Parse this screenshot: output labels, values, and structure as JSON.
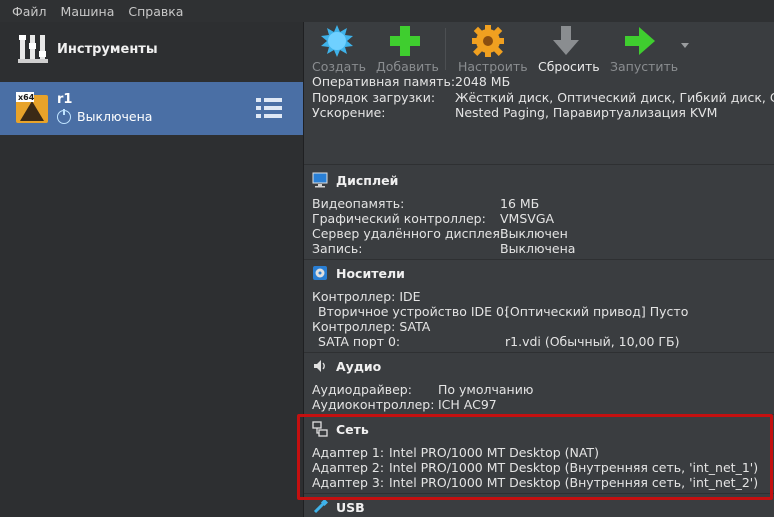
{
  "menu": [
    {
      "label": "Файл"
    },
    {
      "label": "Машина"
    },
    {
      "label": "Справка"
    }
  ],
  "sidebar": {
    "tools_title": "Инструменты",
    "vm": {
      "name": "r1",
      "state": "Выключена",
      "os_badge": "x64"
    }
  },
  "toolbar": {
    "create": "Создать",
    "add": "Добавить",
    "settings": "Настроить",
    "discard": "Сбросить",
    "start": "Запустить"
  },
  "system": {
    "rows": [
      {
        "label": "Оперативная память:",
        "value": "2048 МБ"
      },
      {
        "label": "Порядок загрузки:",
        "value": "Жёсткий диск, Оптический диск, Гибкий диск, Сеть"
      },
      {
        "label": "Ускорение:",
        "value": "Nested Paging, Паравиртуализация KVM"
      }
    ]
  },
  "display": {
    "title": "Дисплей",
    "rows": [
      {
        "label": "Видеопамять:",
        "value": "16 МБ"
      },
      {
        "label": "Графический контроллер:",
        "value": "VMSVGA"
      },
      {
        "label": "Сервер удалённого дисплея:",
        "value": "Выключен"
      },
      {
        "label": "Запись:",
        "value": "Выключена"
      }
    ]
  },
  "storage": {
    "title": "Носители",
    "rows": [
      {
        "label": "Контроллер: IDE",
        "value": ""
      },
      {
        "label": "Вторичное устройство IDE 0:",
        "value": "[Оптический привод] Пусто"
      },
      {
        "label": "Контроллер: SATA",
        "value": ""
      },
      {
        "label": "SATA порт 0:",
        "value": "r1.vdi (Обычный, 10,00 ГБ)"
      }
    ]
  },
  "audio": {
    "title": "Аудио",
    "rows": [
      {
        "label": "Аудиодрайвер:",
        "value": "По умолчанию"
      },
      {
        "label": "Аудиоконтроллер:",
        "value": "ICH AC97"
      }
    ]
  },
  "network": {
    "title": "Сеть",
    "rows": [
      {
        "label": "Адаптер 1:",
        "value": "Intel PRO/1000 MT Desktop (NAT)"
      },
      {
        "label": "Адаптер 2:",
        "value": "Intel PRO/1000 MT Desktop (Внутренняя сеть, 'int_net_1')"
      },
      {
        "label": "Адаптер 3:",
        "value": "Intel PRO/1000 MT Desktop (Внутренняя сеть, 'int_net_2')"
      }
    ]
  },
  "usb": {
    "title": "USB"
  },
  "colors": {
    "selection": "#4a6fa5",
    "highlight_border": "#c41010",
    "background": "#3a3d40"
  }
}
